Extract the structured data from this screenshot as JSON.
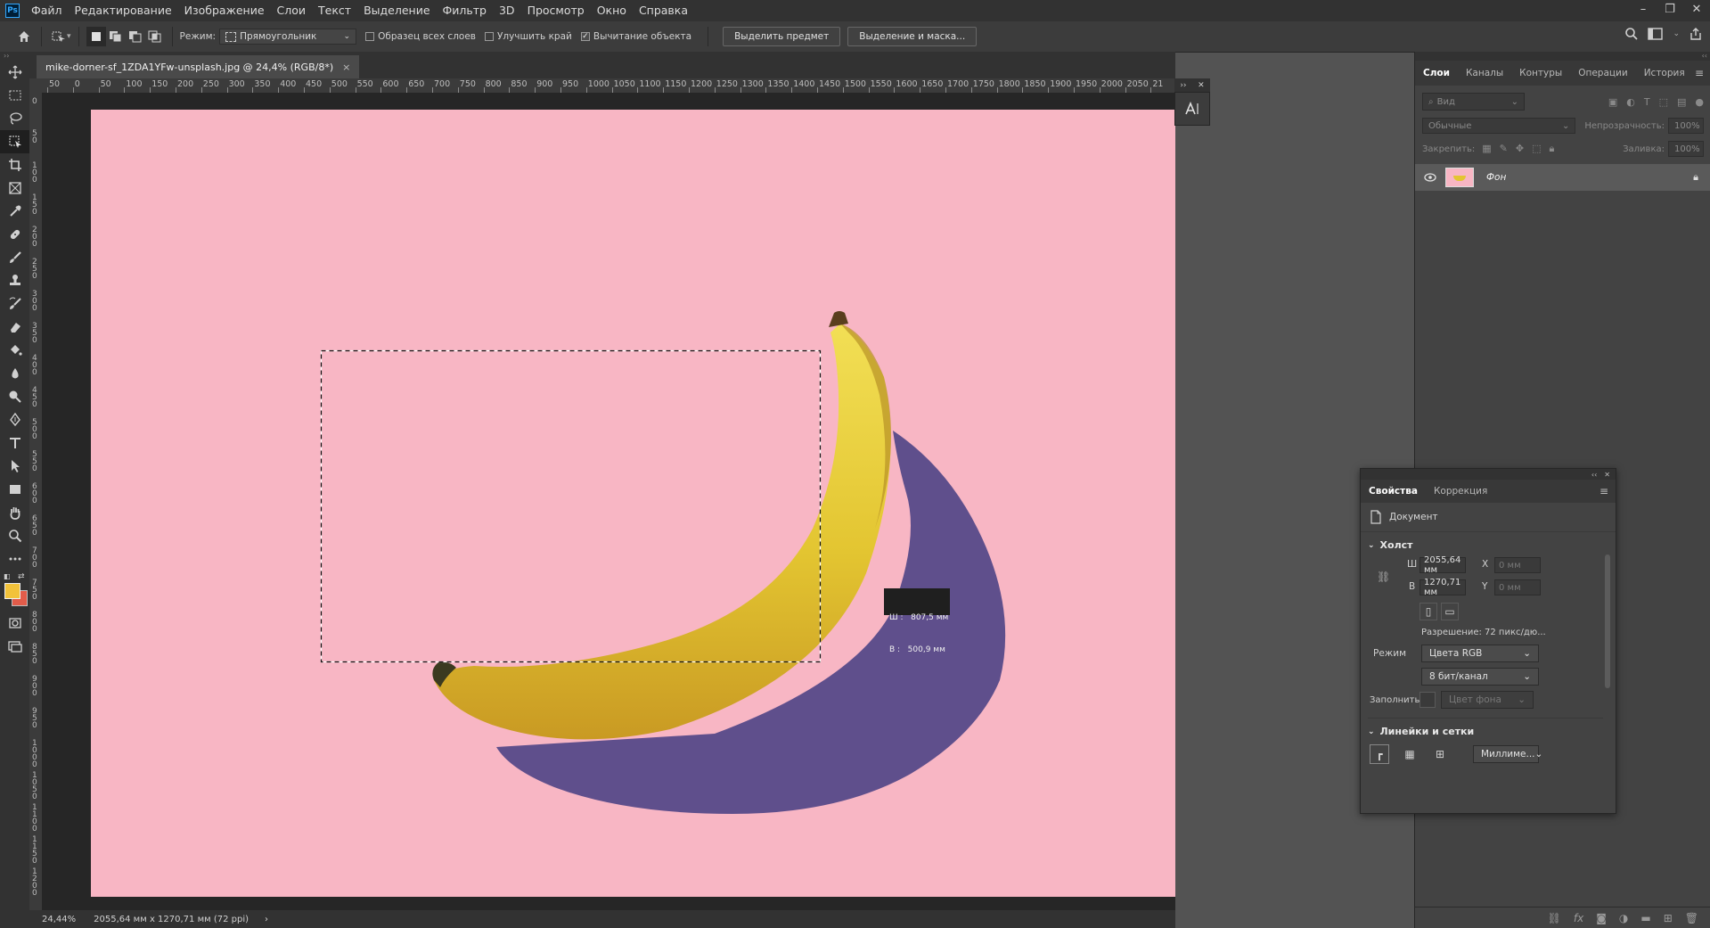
{
  "menu": {
    "items": [
      "Файл",
      "Редактирование",
      "Изображение",
      "Слои",
      "Текст",
      "Выделение",
      "Фильтр",
      "3D",
      "Просмотр",
      "Окно",
      "Справка"
    ],
    "logo": "Ps"
  },
  "window_controls": [
    "–",
    "❐",
    "✕"
  ],
  "options": {
    "mode_label": "Режим:",
    "mode_value": "Прямоугольник",
    "sample_all_layers": "Образец всех слоев",
    "enhance_edge": "Улучшить край",
    "object_subtract": "Вычитание объекта",
    "select_subject": "Выделить предмет",
    "select_and_mask": "Выделение и маска..."
  },
  "document": {
    "tab_title": "mike-dorner-sf_1ZDA1YFw-unsplash.jpg @ 24,4% (RGB/8*)",
    "close": "×"
  },
  "ruler_h": [
    "50",
    "0",
    "50",
    "100",
    "150",
    "200",
    "250",
    "300",
    "350",
    "400",
    "450",
    "500",
    "550",
    "600",
    "650",
    "700",
    "750",
    "800",
    "850",
    "900",
    "950",
    "1000",
    "1050",
    "1100",
    "1150",
    "1200",
    "1250",
    "1300",
    "1350",
    "1400",
    "1450",
    "1500",
    "1550",
    "1600",
    "1650",
    "1700",
    "1750",
    "1800",
    "1850",
    "1900",
    "1950",
    "2000",
    "2050",
    "21"
  ],
  "ruler_v": [
    "0",
    "5 0",
    "1 0 0",
    "1 5 0",
    "2 0 0",
    "2 5 0",
    "3 0 0",
    "3 5 0",
    "4 0 0",
    "4 5 0",
    "5 0 0",
    "5 5 0",
    "6 0 0",
    "6 5 0",
    "7 0 0",
    "7 5 0",
    "8 0 0",
    "8 5 0",
    "9 0 0",
    "9 5 0",
    "1 0 0 0",
    "1 0 5 0",
    "1 1 0 0",
    "1 1 5 0",
    "1 2 0 0"
  ],
  "selection_tooltip": {
    "width": "Ш :   807,5 мм",
    "height": "В :   500,9 мм"
  },
  "status": {
    "zoom": "24,44%",
    "doc_info": "2055,64 мм x 1270,71 мм (72 ppi)",
    "arrow": "›"
  },
  "layers_panel": {
    "tabs": [
      "Слои",
      "Каналы",
      "Контуры",
      "Операции",
      "История"
    ],
    "active_tab": "Слои",
    "search_placeholder": "Вид",
    "blend_mode": "Обычные",
    "opacity_label": "Непрозрачность:",
    "opacity_value": "100%",
    "lock_label": "Закрепить:",
    "fill_label": "Заливка:",
    "fill_value": "100%",
    "layer_name": "Фон"
  },
  "properties": {
    "tabs": [
      "Свойства",
      "Коррекция"
    ],
    "active_tab": "Свойства",
    "doc_label": "Документ",
    "canvas_section": "Холст",
    "w_label": "Ш",
    "w_value": "2055,64 мм",
    "h_label": "В",
    "h_value": "1270,71 мм",
    "x_label": "X",
    "x_value": "0 мм",
    "y_label": "Y",
    "y_value": "0 мм",
    "resolution": "Разрешение: 72 пикс/дю...",
    "mode_label": "Режим",
    "mode_value": "Цвета RGB",
    "bit_value": "8 бит/канал",
    "fill_label": "Заполнить",
    "fill_value": "Цвет фона",
    "rulers_section": "Линейки и сетки",
    "units_value": "Миллиме..."
  },
  "colors": {
    "canvas_bg": "#f8b6c4",
    "shadow": "#5f4f8c",
    "banana": "#e9d23a",
    "foreground": "#f2c23a",
    "background": "#e25c4a"
  }
}
